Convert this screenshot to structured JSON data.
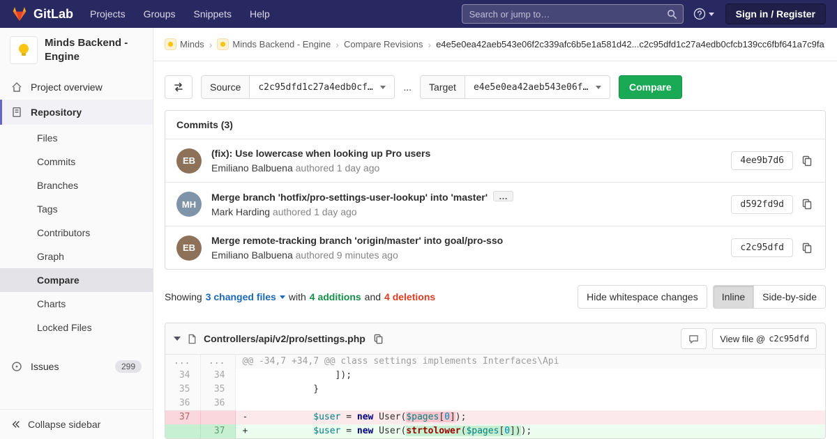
{
  "navbar": {
    "logo_text": "GitLab",
    "menu": [
      "Projects",
      "Groups",
      "Snippets",
      "Help"
    ],
    "search_placeholder": "Search or jump to…",
    "signin_label": "Sign in / Register"
  },
  "sidebar": {
    "project_title": "Minds Backend - Engine",
    "overview_label": "Project overview",
    "repository_label": "Repository",
    "repo_items": [
      "Files",
      "Commits",
      "Branches",
      "Tags",
      "Contributors",
      "Graph",
      "Compare",
      "Charts",
      "Locked Files"
    ],
    "issues_label": "Issues",
    "issues_count": "299",
    "collapse_label": "Collapse sidebar"
  },
  "breadcrumb": {
    "items": [
      "Minds",
      "Minds Backend - Engine",
      "Compare Revisions"
    ],
    "current": "e4e5e0ea42aeb543e06f2c339afc6b5e1a581d42...c2c95dfd1c27a4edb0cfcb139cc6fbf641a7c9fa"
  },
  "compare_form": {
    "source_label": "Source",
    "source_value": "c2c95dfd1c27a4edb0cf…",
    "separator": "...",
    "target_label": "Target",
    "target_value": "e4e5e0ea42aeb543e06f…",
    "compare_button": "Compare"
  },
  "commits": {
    "header": "Commits (3)",
    "expander_glyph": "…",
    "list": [
      {
        "title": "(fix): Use lowercase when looking up Pro users",
        "author": "Emiliano Balbuena",
        "meta": "authored 1 day ago",
        "sha": "4ee9b7d6",
        "initials": "EB"
      },
      {
        "title": "Merge branch 'hotfix/pro-settings-user-lookup' into 'master'",
        "author": "Mark Harding",
        "meta": "authored 1 day ago",
        "sha": "d592fd9d",
        "initials": "MH"
      },
      {
        "title": "Merge remote-tracking branch 'origin/master' into goal/pro-sso",
        "author": "Emiliano Balbuena",
        "meta": "authored 9 minutes ago",
        "sha": "c2c95dfd",
        "initials": "EB"
      }
    ]
  },
  "summary": {
    "showing": "Showing",
    "changed_files": "3 changed files",
    "with_text": "with",
    "additions": "4 additions",
    "and_text": "and",
    "deletions": "4 deletions",
    "whitespace_button": "Hide whitespace changes",
    "inline_button": "Inline",
    "side_by_side_button": "Side-by-side"
  },
  "diff": {
    "filename": "Controllers/api/v2/pro/settings.php",
    "view_file_label": "View file @",
    "view_file_sha": "c2c95dfd",
    "rows": [
      {
        "type": "hunk",
        "old": "...",
        "new": "...",
        "tokens": [
          {
            "t": "@@ -34,7 +34,7 @@ class settings implements Interfaces\\Api",
            "c": "hunk"
          }
        ]
      },
      {
        "type": "context",
        "old": "34",
        "new": "34",
        "tokens": [
          {
            "t": "                 ]);",
            "c": ""
          }
        ]
      },
      {
        "type": "context",
        "old": "35",
        "new": "35",
        "tokens": [
          {
            "t": "             }",
            "c": ""
          }
        ]
      },
      {
        "type": "context",
        "old": "36",
        "new": "36",
        "tokens": [
          {
            "t": "",
            "c": ""
          }
        ]
      },
      {
        "type": "del",
        "old": "37",
        "new": "",
        "tokens": [
          {
            "t": "-",
            "c": ""
          },
          {
            "t": "            ",
            "c": ""
          },
          {
            "t": "$user",
            "c": "nv"
          },
          {
            "t": " = ",
            "c": ""
          },
          {
            "t": "new",
            "c": "k"
          },
          {
            "t": " User(",
            "c": ""
          },
          {
            "t": "$pages",
            "c": "nv hl"
          },
          {
            "t": "[",
            "c": "hl"
          },
          {
            "t": "0",
            "c": "mi hl"
          },
          {
            "t": "]",
            "c": "hl"
          },
          {
            "t": ");",
            "c": ""
          }
        ]
      },
      {
        "type": "add",
        "old": "",
        "new": "37",
        "tokens": [
          {
            "t": "+",
            "c": ""
          },
          {
            "t": "            ",
            "c": ""
          },
          {
            "t": "$user",
            "c": "nv"
          },
          {
            "t": " = ",
            "c": ""
          },
          {
            "t": "new",
            "c": "k"
          },
          {
            "t": " User(",
            "c": ""
          },
          {
            "t": "strtolower",
            "c": "nf hl"
          },
          {
            "t": "(",
            "c": "hl"
          },
          {
            "t": "$pages",
            "c": "nv hl"
          },
          {
            "t": "[",
            "c": "hl"
          },
          {
            "t": "0",
            "c": "mi hl"
          },
          {
            "t": "]",
            "c": "hl"
          },
          {
            "t": ")",
            "c": "hl"
          },
          {
            "t": ");",
            "c": ""
          }
        ]
      }
    ]
  }
}
